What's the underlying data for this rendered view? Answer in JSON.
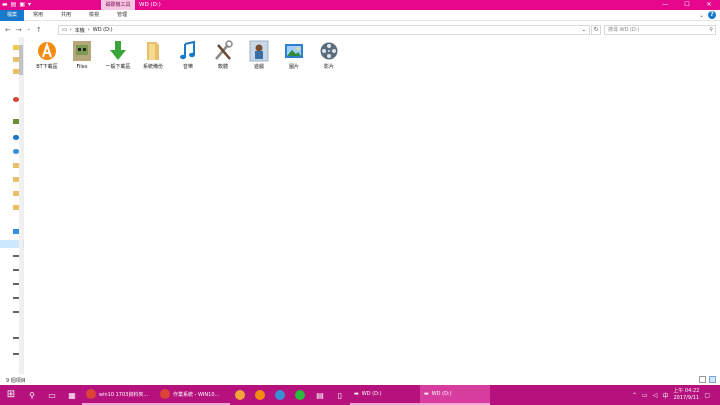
{
  "titlebar": {
    "context_tab": "磁碟機工具",
    "window_title": "WD (D:)",
    "minimize": "—",
    "maximize": "☐",
    "close": "✕"
  },
  "ribbon": {
    "tabs": [
      {
        "label": "檔案"
      },
      {
        "label": "常用"
      },
      {
        "label": "共用"
      },
      {
        "label": "檢視"
      },
      {
        "label": "管理"
      }
    ]
  },
  "addressbar": {
    "path": [
      "本機",
      "WD (D:)"
    ],
    "search_placeholder": "搜尋 WD (D:)"
  },
  "items": [
    {
      "label": "BT下載區",
      "icon": "orange-sphere-icon"
    },
    {
      "label": "Files",
      "icon": "minecraft-icon"
    },
    {
      "label": "一般下載區",
      "icon": "download-arrow-icon"
    },
    {
      "label": "系統備份",
      "icon": "folder-icon"
    },
    {
      "label": "音樂",
      "icon": "music-note-icon"
    },
    {
      "label": "軟體",
      "icon": "tools-icon"
    },
    {
      "label": "遊戲",
      "icon": "game-icon"
    },
    {
      "label": "圖片",
      "icon": "pictures-icon"
    },
    {
      "label": "影片",
      "icon": "film-reel-icon"
    }
  ],
  "statusbar": {
    "count": "9 個項目"
  },
  "taskbar": {
    "apps": [
      {
        "label": "win10 1703資料夾..."
      },
      {
        "label": "作業系統 - WIN10..."
      }
    ],
    "windows": [
      {
        "label": "WD (D:)"
      },
      {
        "label": "WD (D:)"
      }
    ],
    "ime": "中",
    "time": "上午 04:22",
    "date": "2017/9/11"
  },
  "colors": {
    "accent": "#e5078c",
    "taskbar": "#b5127d",
    "file_tab": "#1979ca"
  }
}
